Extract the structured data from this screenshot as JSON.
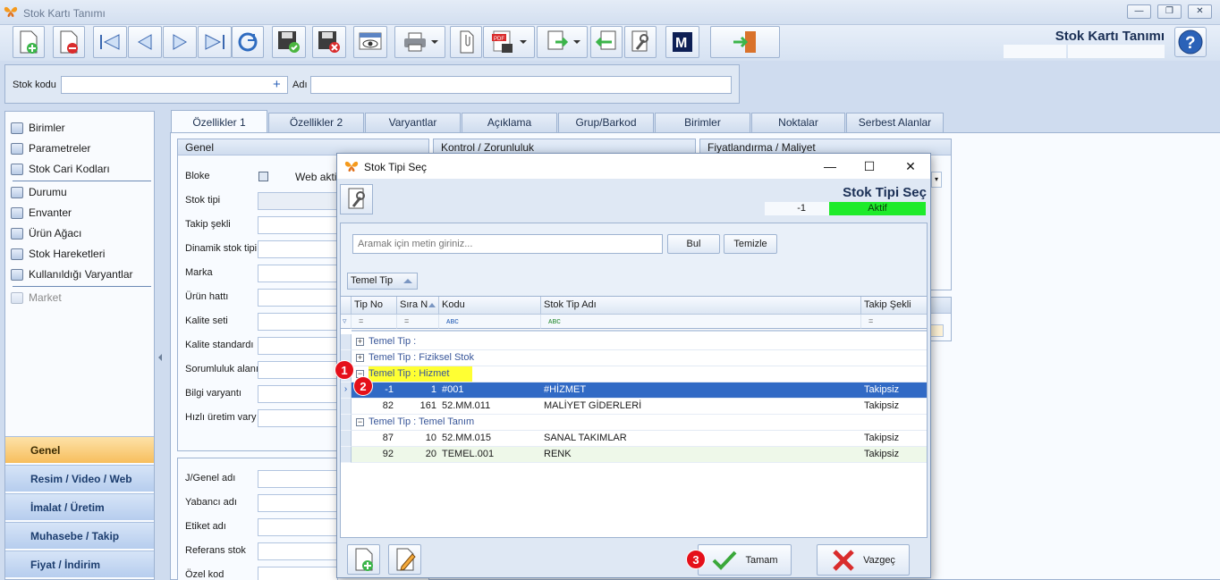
{
  "window": {
    "title": "Stok Kartı Tanımı",
    "header_title": "Stok Kartı Tanımı"
  },
  "stok_bar": {
    "code_label": "Stok kodu",
    "code_value": "",
    "name_label": "Adı",
    "name_value": ""
  },
  "left_nav": {
    "items": [
      {
        "label": "Birimler",
        "enabled": true
      },
      {
        "label": "Parametreler",
        "enabled": true
      },
      {
        "label": "Stok Cari Kodları",
        "enabled": true
      },
      {
        "label": "Durumu",
        "enabled": true
      },
      {
        "label": "Envanter",
        "enabled": true
      },
      {
        "label": "Ürün Ağacı",
        "enabled": true
      },
      {
        "label": "Stok Hareketleri",
        "enabled": true
      },
      {
        "label": "Kullanıldığı Varyantlar",
        "enabled": true
      },
      {
        "label": "Market",
        "enabled": false
      }
    ],
    "sections": [
      "Genel",
      "Resim / Video / Web",
      "İmalat / Üretim",
      "Muhasebe / Takip",
      "Fiyat / İndirim"
    ],
    "active_section": "Genel"
  },
  "tabs": [
    "Özellikler 1",
    "Özellikler 2",
    "Varyantlar",
    "Açıklama",
    "Grup/Barkod",
    "Birimler",
    "Noktalar",
    "Serbest Alanlar"
  ],
  "active_tab": "Özellikler 1",
  "groups": {
    "genel": {
      "title": "Genel",
      "fields": [
        "Bloke",
        "Stok tipi",
        "Takip şekli",
        "Dinamik stok tipi",
        "Marka",
        "Ürün hattı",
        "Kalite seti",
        "Kalite standardı",
        "Sorumluluk alanı",
        "Bilgi varyantı",
        "Hızlı üretim vary"
      ],
      "web_label": "Web aktif"
    },
    "kontrol": {
      "title": "Kontrol / Zorunluluk"
    },
    "fiyat": {
      "title": "Fiyatlandırma / Maliyet"
    },
    "names": {
      "fields": [
        "J/Genel adı",
        "Yabancı adı",
        "Etiket adı",
        "Referans stok",
        "Özel kod"
      ]
    }
  },
  "dialog": {
    "title": "Stok Tipi Seç",
    "header_title": "Stok Tipi Seç",
    "status_number": "-1",
    "status_text": "Aktif",
    "status_color": "#1eeb2a",
    "search_placeholder": "Aramak için metin giriniz...",
    "search_button": "Bul",
    "clear_button": "Temizle",
    "group_chip": "Temel Tip",
    "columns": [
      "Tip No",
      "Sıra N",
      "Kodu",
      "Stok Tip Adı",
      "Takip Şekli"
    ],
    "groups": [
      {
        "label": "Temel Tip :",
        "expanded": false,
        "highlight": false,
        "rows": []
      },
      {
        "label": "Temel Tip : Fiziksel Stok",
        "expanded": false,
        "highlight": false,
        "rows": []
      },
      {
        "label": "Temel Tip : Hizmet",
        "expanded": true,
        "highlight": true,
        "rows": [
          {
            "tip_no": "-1",
            "sira": "1",
            "kodu": "#001",
            "ad": "#HİZMET",
            "takip": "Takipsiz",
            "selected": true
          },
          {
            "tip_no": "82",
            "sira": "161",
            "kodu": "52.MM.011",
            "ad": "MALİYET GİDERLERİ",
            "takip": "Takipsiz",
            "selected": false
          }
        ]
      },
      {
        "label": "Temel Tip : Temel Tanım",
        "expanded": true,
        "highlight": false,
        "rows": [
          {
            "tip_no": "87",
            "sira": "10",
            "kodu": "52.MM.015",
            "ad": "SANAL TAKIMLAR",
            "takip": "Takipsiz",
            "selected": false
          },
          {
            "tip_no": "92",
            "sira": "20",
            "kodu": "TEMEL.001",
            "ad": "RENK",
            "takip": "Takipsiz",
            "selected": false
          }
        ]
      }
    ],
    "ok_button": "Tamam",
    "cancel_button": "Vazgeç"
  },
  "badges": [
    "1",
    "2",
    "3"
  ]
}
